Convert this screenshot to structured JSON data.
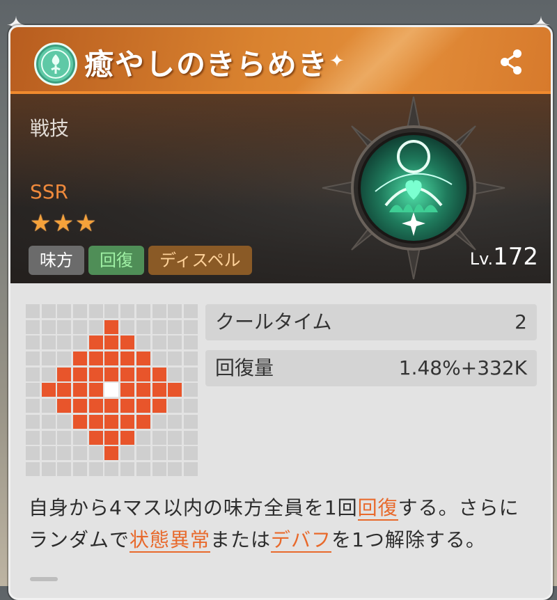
{
  "skill": {
    "title": "癒やしのきらめき",
    "category": "戦技",
    "rarity": "SSR",
    "stars": 3,
    "level_prefix": "Lv.",
    "level": "172",
    "tags": [
      "味方",
      "回復",
      "ディスペル"
    ]
  },
  "stats": [
    {
      "label": "クールタイム",
      "value": "2"
    },
    {
      "label": "回復量",
      "value": "1.48%+332K"
    }
  ],
  "description": {
    "p1": "自身から4マス以内の味方全員を1回",
    "kw1": "回復",
    "p2": "する。さらに",
    "p3": "ランダムで",
    "kw2": "状態異常",
    "p4": "または",
    "kw3": "デバフ",
    "p5": "を1つ解除する。"
  },
  "range_grid": {
    "size": 11,
    "center": [
      5,
      5
    ],
    "radius": 4,
    "shape": "diamond"
  },
  "colors": {
    "accent": "#e8552b",
    "header": "#d9822f",
    "heal_tag": "#4f8e57",
    "dispel_tag": "#8a5a26"
  },
  "icons": {
    "emblem": "tree-emblem-icon",
    "share": "share-icon",
    "skill": "healing-heart-icon"
  }
}
